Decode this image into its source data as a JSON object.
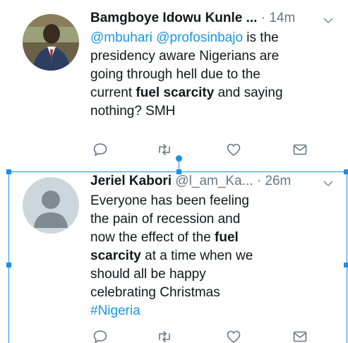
{
  "tweets": [
    {
      "name": "Bamgboye Idowu Kunle ...",
      "dot": " · ",
      "time": "14m",
      "lines": [
        [
          {
            "t": "@mbuhari",
            "k": "link"
          },
          {
            "t": " ",
            "k": ""
          },
          {
            "t": "@profosinbajo",
            "k": "link"
          },
          {
            "t": " is the",
            "k": ""
          }
        ],
        [
          {
            "t": "presidency aware Nigerians are",
            "k": ""
          }
        ],
        [
          {
            "t": "going through hell due to the",
            "k": ""
          }
        ],
        [
          {
            "t": "current ",
            "k": ""
          },
          {
            "t": "fuel scarcity",
            "k": "bold"
          },
          {
            "t": " and saying",
            "k": ""
          }
        ],
        [
          {
            "t": "nothing? SMH",
            "k": ""
          }
        ]
      ]
    },
    {
      "name": "Jeriel Kabori",
      "handle": "@l_am_Ka...",
      "dot": " · ",
      "time": "26m",
      "lines": [
        [
          {
            "t": "Everyone has been feeling",
            "k": ""
          }
        ],
        [
          {
            "t": "the pain of recession and",
            "k": ""
          }
        ],
        [
          {
            "t": "now the effect of the ",
            "k": ""
          },
          {
            "t": "fuel",
            "k": "bold"
          }
        ],
        [
          {
            "t": "scarcity",
            "k": "bold"
          },
          {
            "t": " at a time when we",
            "k": ""
          }
        ],
        [
          {
            "t": "should all be happy",
            "k": ""
          }
        ],
        [
          {
            "t": "celebrating Christmas",
            "k": ""
          }
        ],
        [
          {
            "t": "#Nigeria",
            "k": "link"
          }
        ]
      ]
    }
  ],
  "icons": {
    "reply": "reply-icon",
    "retweet": "retweet-icon",
    "like": "heart-icon",
    "dm": "envelope-icon",
    "more": "chevron-down-icon"
  },
  "colors": {
    "link": "#1b95e0",
    "muted": "#657786",
    "selection": "#1a8fe8"
  }
}
